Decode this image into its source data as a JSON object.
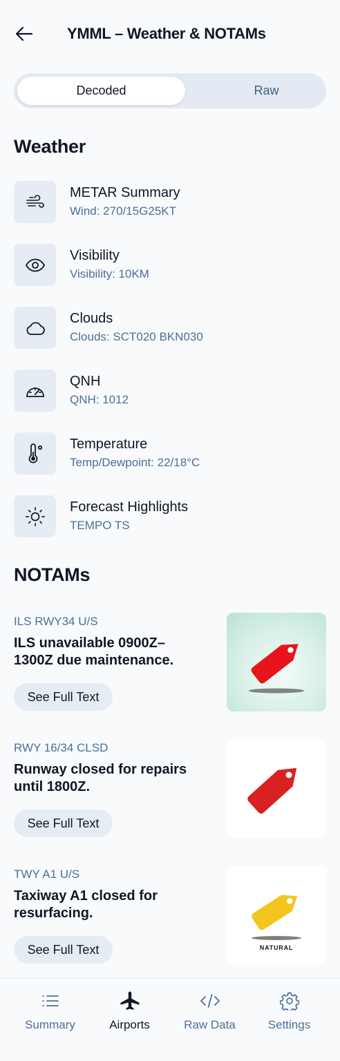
{
  "header": {
    "title": "YMML – Weather & NOTAMs",
    "back_icon": "arrow-left-icon"
  },
  "toggle": {
    "options": [
      "Decoded",
      "Raw"
    ],
    "selected": "Decoded"
  },
  "weather": {
    "title": "Weather",
    "items": [
      {
        "icon": "wind-icon",
        "label": "METAR Summary",
        "value": "Wind: 270/15G25KT"
      },
      {
        "icon": "eye-icon",
        "label": "Visibility",
        "value": "Visibility: 10KM"
      },
      {
        "icon": "cloud-icon",
        "label": "Clouds",
        "value": "Clouds: SCT020 BKN030"
      },
      {
        "icon": "gauge-icon",
        "label": "QNH",
        "value": "QNH: 1012"
      },
      {
        "icon": "thermometer-icon",
        "label": "Temperature",
        "value": "Temp/Dewpoint: 22/18°C"
      },
      {
        "icon": "sun-icon",
        "label": "Forecast Highlights",
        "value": "TEMPO TS"
      }
    ]
  },
  "notams": {
    "title": "NOTAMs",
    "button_label": "See Full Text",
    "items": [
      {
        "code": "ILS RWY34 U/S",
        "description": "ILS unavailable 0900Z–1300Z due maintenance.",
        "image": "red-tag-icon",
        "tag_color": "#e8141b"
      },
      {
        "code": "RWY 16/34 CLSD",
        "description": "Runway closed for repairs until 1800Z.",
        "image": "red-tag-icon",
        "tag_color": "#d92121"
      },
      {
        "code": "TWY A1 U/S",
        "description": "Taxiway A1 closed for resurfacing.",
        "image": "yellow-tag-icon",
        "tag_color": "#f4c51e",
        "image_caption": "NATURAL"
      }
    ]
  },
  "bottom_nav": {
    "items": [
      {
        "icon": "list-icon",
        "label": "Summary"
      },
      {
        "icon": "airplane-icon",
        "label": "Airports"
      },
      {
        "icon": "code-icon",
        "label": "Raw Data"
      },
      {
        "icon": "gear-icon",
        "label": "Settings"
      }
    ],
    "active": "Airports"
  },
  "colors": {
    "accent_text": "#4a6f97",
    "primary_text": "#0f1724",
    "chip_bg": "#e6ecf3"
  }
}
